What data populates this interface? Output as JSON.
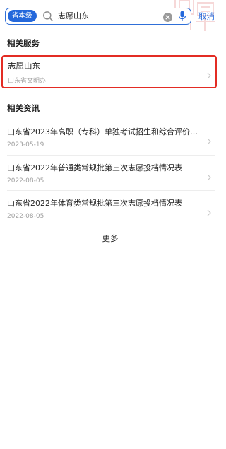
{
  "search": {
    "scope_chip": "省本级",
    "query": "志愿山东",
    "cancel_label": "取消"
  },
  "icons": {
    "search": "search-icon",
    "clear": "clear-icon",
    "mic": "microphone-icon",
    "chevron": "chevron-right-icon"
  },
  "services": {
    "heading": "相关服务",
    "items": [
      {
        "name": "志愿山东",
        "org": "山东省文明办"
      }
    ]
  },
  "news": {
    "heading": "相关资讯",
    "items": [
      {
        "title": "山东省2023年高职（专科）单独考试招生和综合评价招…",
        "date": "2023-05-19"
      },
      {
        "title": "山东省2022年普通类常规批第三次志愿投档情况表",
        "date": "2022-08-05"
      },
      {
        "title": "山东省2022年体育类常规批第三次志愿投档情况表",
        "date": "2022-08-05"
      }
    ],
    "more_label": "更多"
  },
  "colors": {
    "accent": "#2468db",
    "highlight_border": "#e32c24",
    "secondary_text": "#a0a0a0"
  }
}
